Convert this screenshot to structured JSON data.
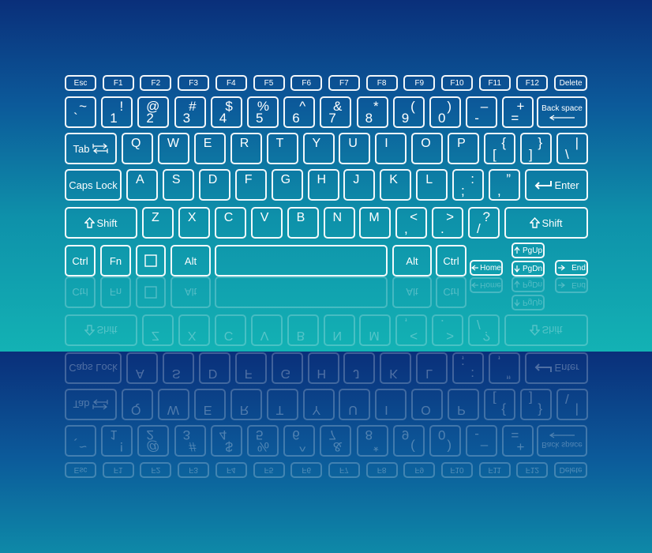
{
  "fn_row": [
    "Esc",
    "F1",
    "F2",
    "F3",
    "F4",
    "F5",
    "F6",
    "F7",
    "F8",
    "F9",
    "F10",
    "F11",
    "F12",
    "Delete"
  ],
  "number_row": [
    {
      "top": "~",
      "bottom": "`"
    },
    {
      "top": "!",
      "bottom": "1"
    },
    {
      "top": "@",
      "bottom": "2"
    },
    {
      "top": "#",
      "bottom": "3"
    },
    {
      "top": "$",
      "bottom": "4"
    },
    {
      "top": "%",
      "bottom": "5"
    },
    {
      "top": "^",
      "bottom": "6"
    },
    {
      "top": "&",
      "bottom": "7"
    },
    {
      "top": "*",
      "bottom": "8"
    },
    {
      "top": "(",
      "bottom": "9"
    },
    {
      "top": ")",
      "bottom": "0"
    },
    {
      "top": "–",
      "bottom": "-"
    },
    {
      "top": "+",
      "bottom": "="
    }
  ],
  "backspace_label": "Back space",
  "tab_label": "Tab",
  "row_q": [
    "Q",
    "W",
    "E",
    "R",
    "T",
    "Y",
    "U",
    "I",
    "O",
    "P"
  ],
  "row_q_sym": [
    {
      "top": "{",
      "bottom": "["
    },
    {
      "top": "}",
      "bottom": "]"
    },
    {
      "top": "|",
      "bottom": "\\"
    }
  ],
  "caps_label": "Caps Lock",
  "row_a": [
    "A",
    "S",
    "D",
    "F",
    "G",
    "H",
    "J",
    "K",
    "L"
  ],
  "row_a_sym": [
    {
      "top": ":",
      "bottom": ";"
    },
    {
      "top": "”",
      "bottom": ","
    }
  ],
  "enter_label": "Enter",
  "shift_label": "Shift",
  "row_z": [
    "Z",
    "X",
    "C",
    "V",
    "B",
    "N",
    "M"
  ],
  "row_z_sym": [
    {
      "top": "<",
      "bottom": ","
    },
    {
      "top": ">",
      "bottom": "."
    },
    {
      "top": "?",
      "bottom": "/"
    }
  ],
  "ctrl_label": "Ctrl",
  "fn_label": "Fn",
  "alt_label": "Alt",
  "home_label": "Home",
  "pgup_label": "PgUp",
  "pgdn_label": "PgDn",
  "end_label": "End",
  "icons": {
    "shift": "shift-arrow-icon",
    "enter": "return-arrow-icon",
    "tab": "tab-arrows-icon",
    "backspace": "left-arrow-icon",
    "windows": "windows-square-icon"
  },
  "colors": {
    "bg_top": "#0a2f7a",
    "bg_bottom": "#13b2b4",
    "key_stroke": "#ffffff"
  }
}
